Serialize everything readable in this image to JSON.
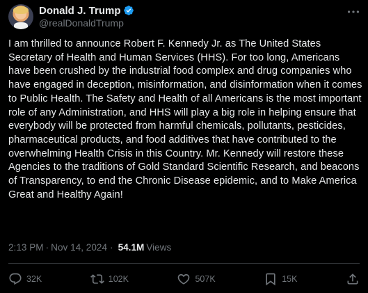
{
  "author": {
    "display_name": "Donald J. Trump",
    "handle": "@realDonaldTrump",
    "verified_badge_color": "#1d9bf0"
  },
  "post": {
    "text": "I am thrilled to announce Robert F. Kennedy Jr. as The United States Secretary of Health and Human Services (HHS). For too long, Americans have been crushed by the industrial food complex and drug companies who have engaged in deception, misinformation, and disinformation when it comes to Public Health. The Safety and Health of all Americans is the most important role of any Administration, and HHS will play a big role in helping ensure that everybody will be protected from harmful chemicals, pollutants, pesticides, pharmaceutical products, and food additives that have contributed to the overwhelming Health Crisis in this Country. Mr. Kennedy will restore these Agencies to the traditions of Gold Standard Scientific Research, and beacons of Transparency, to end the Chronic Disease epidemic, and to Make America Great and Healthy Again!",
    "time": "2:13 PM",
    "separator": "·",
    "date": "Nov 14, 2024",
    "views_count": "54.1M",
    "views_label": "Views"
  },
  "actions": {
    "reply": {
      "icon": "reply-icon",
      "count": "32K"
    },
    "repost": {
      "icon": "repost-icon",
      "count": "102K"
    },
    "like": {
      "icon": "heart-icon",
      "count": "507K"
    },
    "bookmark": {
      "icon": "bookmark-icon",
      "count": "15K"
    },
    "share": {
      "icon": "share-icon"
    }
  },
  "colors": {
    "background": "#000000",
    "text": "#e7e9ea",
    "secondary_text": "#71767b",
    "divider": "#2f3336"
  }
}
